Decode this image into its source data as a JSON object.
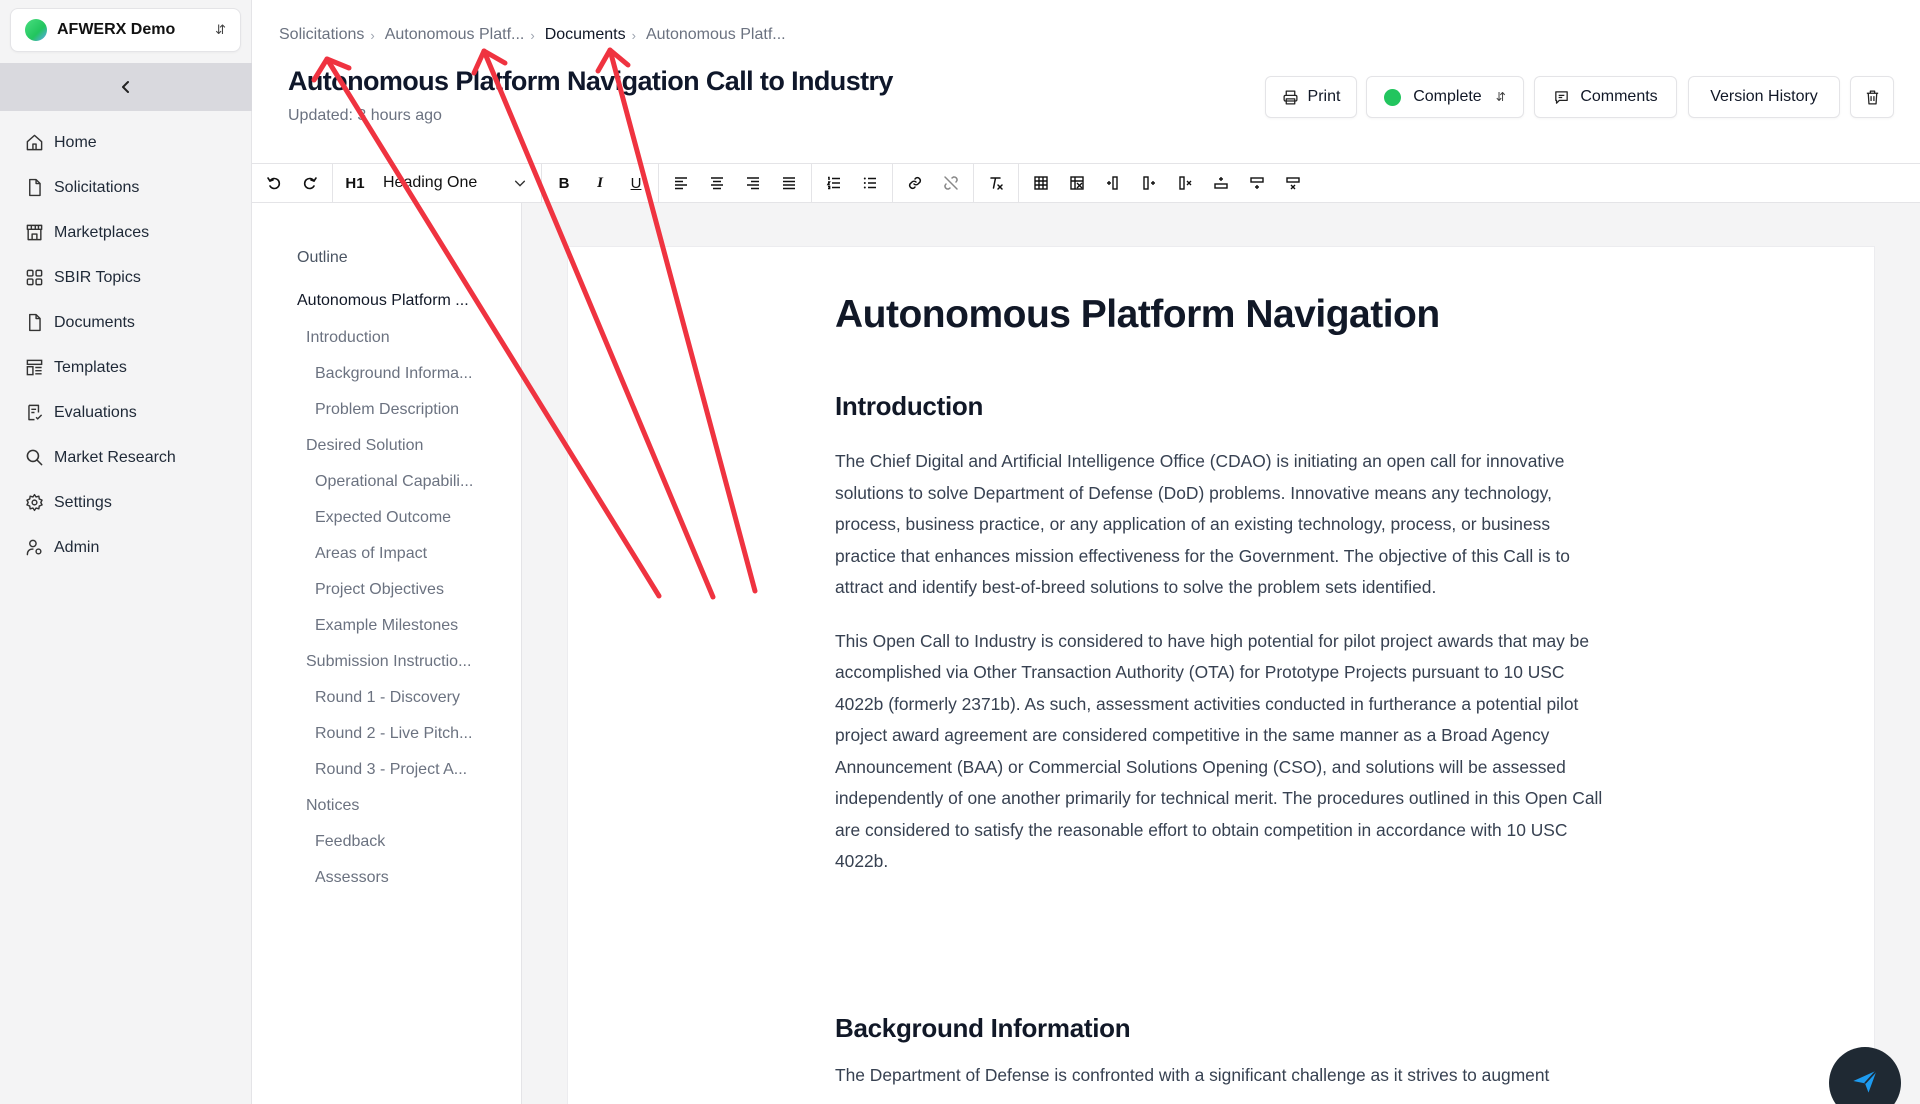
{
  "workspace": {
    "name": "AFWERX Demo"
  },
  "sidebar": {
    "items": [
      {
        "label": "Home",
        "icon": "home-icon"
      },
      {
        "label": "Solicitations",
        "icon": "file-icon"
      },
      {
        "label": "Marketplaces",
        "icon": "store-icon"
      },
      {
        "label": "SBIR Topics",
        "icon": "grid-icon"
      },
      {
        "label": "Documents",
        "icon": "file-icon"
      },
      {
        "label": "Templates",
        "icon": "layout-icon"
      },
      {
        "label": "Evaluations",
        "icon": "clipboard-icon"
      },
      {
        "label": "Market Research",
        "icon": "search-icon"
      },
      {
        "label": "Settings",
        "icon": "gear-icon"
      },
      {
        "label": "Admin",
        "icon": "user-cog-icon"
      }
    ]
  },
  "breadcrumb": [
    "Solicitations",
    "Autonomous Platf...",
    "Documents",
    "Autonomous Platf..."
  ],
  "header": {
    "title": "Autonomous Platform Navigation Call to Industry",
    "updated": "Updated: 3 hours ago",
    "print_label": "Print",
    "status_label": "Complete",
    "status_color": "#22c55e",
    "comments_label": "Comments",
    "history_label": "Version History"
  },
  "toolbar": {
    "block_style": "Heading One",
    "heading_glyph": "H1",
    "bold": "B",
    "italic": "I",
    "underline": "U"
  },
  "outline": {
    "title": "Outline",
    "items": [
      {
        "label": "Autonomous Platform ...",
        "level": 0
      },
      {
        "label": "Introduction",
        "level": 1
      },
      {
        "label": "Background Informa...",
        "level": 2
      },
      {
        "label": "Problem Description",
        "level": 2
      },
      {
        "label": "Desired Solution",
        "level": 1
      },
      {
        "label": "Operational Capabili...",
        "level": 2
      },
      {
        "label": "Expected Outcome",
        "level": 2
      },
      {
        "label": "Areas of Impact",
        "level": 2
      },
      {
        "label": "Project Objectives",
        "level": 2
      },
      {
        "label": "Example Milestones",
        "level": 2
      },
      {
        "label": "Submission Instructio...",
        "level": 1
      },
      {
        "label": "Round 1 - Discovery",
        "level": 2
      },
      {
        "label": "Round 2 - Live Pitch...",
        "level": 2
      },
      {
        "label": "Round 3 - Project A...",
        "level": 2
      },
      {
        "label": "Notices",
        "level": 1
      },
      {
        "label": "Feedback",
        "level": 2
      },
      {
        "label": "Assessors",
        "level": 2
      }
    ]
  },
  "document": {
    "h1": "Autonomous Platform Navigation",
    "intro_heading": "Introduction",
    "p1": "The Chief Digital and Artificial Intelligence Office (CDAO) is initiating an open call for innovative solutions to solve Department of Defense (DoD) problems. Innovative means any technology, process, business practice, or any application of an existing technology, process, or business practice that enhances mission effectiveness for the Government. The objective of this Call is to attract and identify best-of-breed solutions to solve the problem sets identified.",
    "p2": "This Open Call to Industry is considered to have high potential for pilot project awards that may be accomplished via Other Transaction Authority (OTA) for Prototype Projects pursuant to 10 USC 4022b (formerly 2371b). As such, assessment activities conducted in furtherance a potential pilot project award agreement are considered competitive in the same manner as a Broad Agency Announcement (BAA) or Commercial Solutions Opening (CSO), and solutions will be assessed independently of one another primarily for technical merit. The procedures outlined in this Open Call are considered to satisfy the reasonable effort to obtain competition in accordance with 10 USC 4022b.",
    "bg_heading": "Background Information",
    "p3": "The Department of Defense is confronted with a significant challenge as it strives to augment"
  },
  "colors": {
    "annotation": "#ef3340",
    "sidebar_bg": "#f4f4f5",
    "fab_bg": "#1f2933",
    "fab_icon": "#1d9bf0"
  }
}
